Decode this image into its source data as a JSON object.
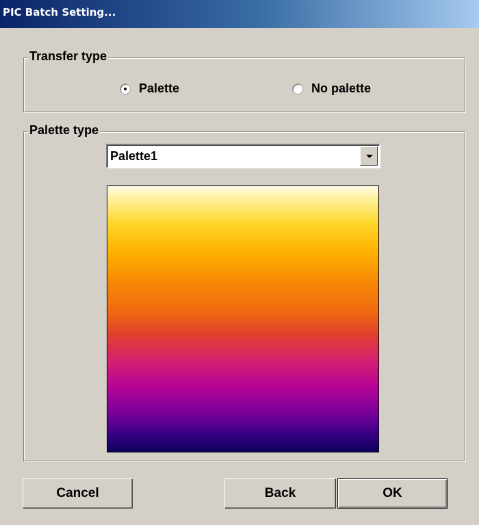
{
  "window": {
    "title": "PIC Batch Setting..."
  },
  "transfer_type": {
    "legend": "Transfer type",
    "options": [
      {
        "label": "Palette",
        "selected": true
      },
      {
        "label": "No palette",
        "selected": false
      }
    ]
  },
  "palette_type": {
    "legend": "Palette type",
    "selected": "Palette1",
    "preview_colors": [
      "#fffbe8",
      "#ffd62a",
      "#f88c06",
      "#e0402e",
      "#d61f72",
      "#b80596",
      "#3a0086",
      "#0a005a"
    ]
  },
  "buttons": {
    "cancel": "Cancel",
    "back": "Back",
    "ok": "OK"
  }
}
